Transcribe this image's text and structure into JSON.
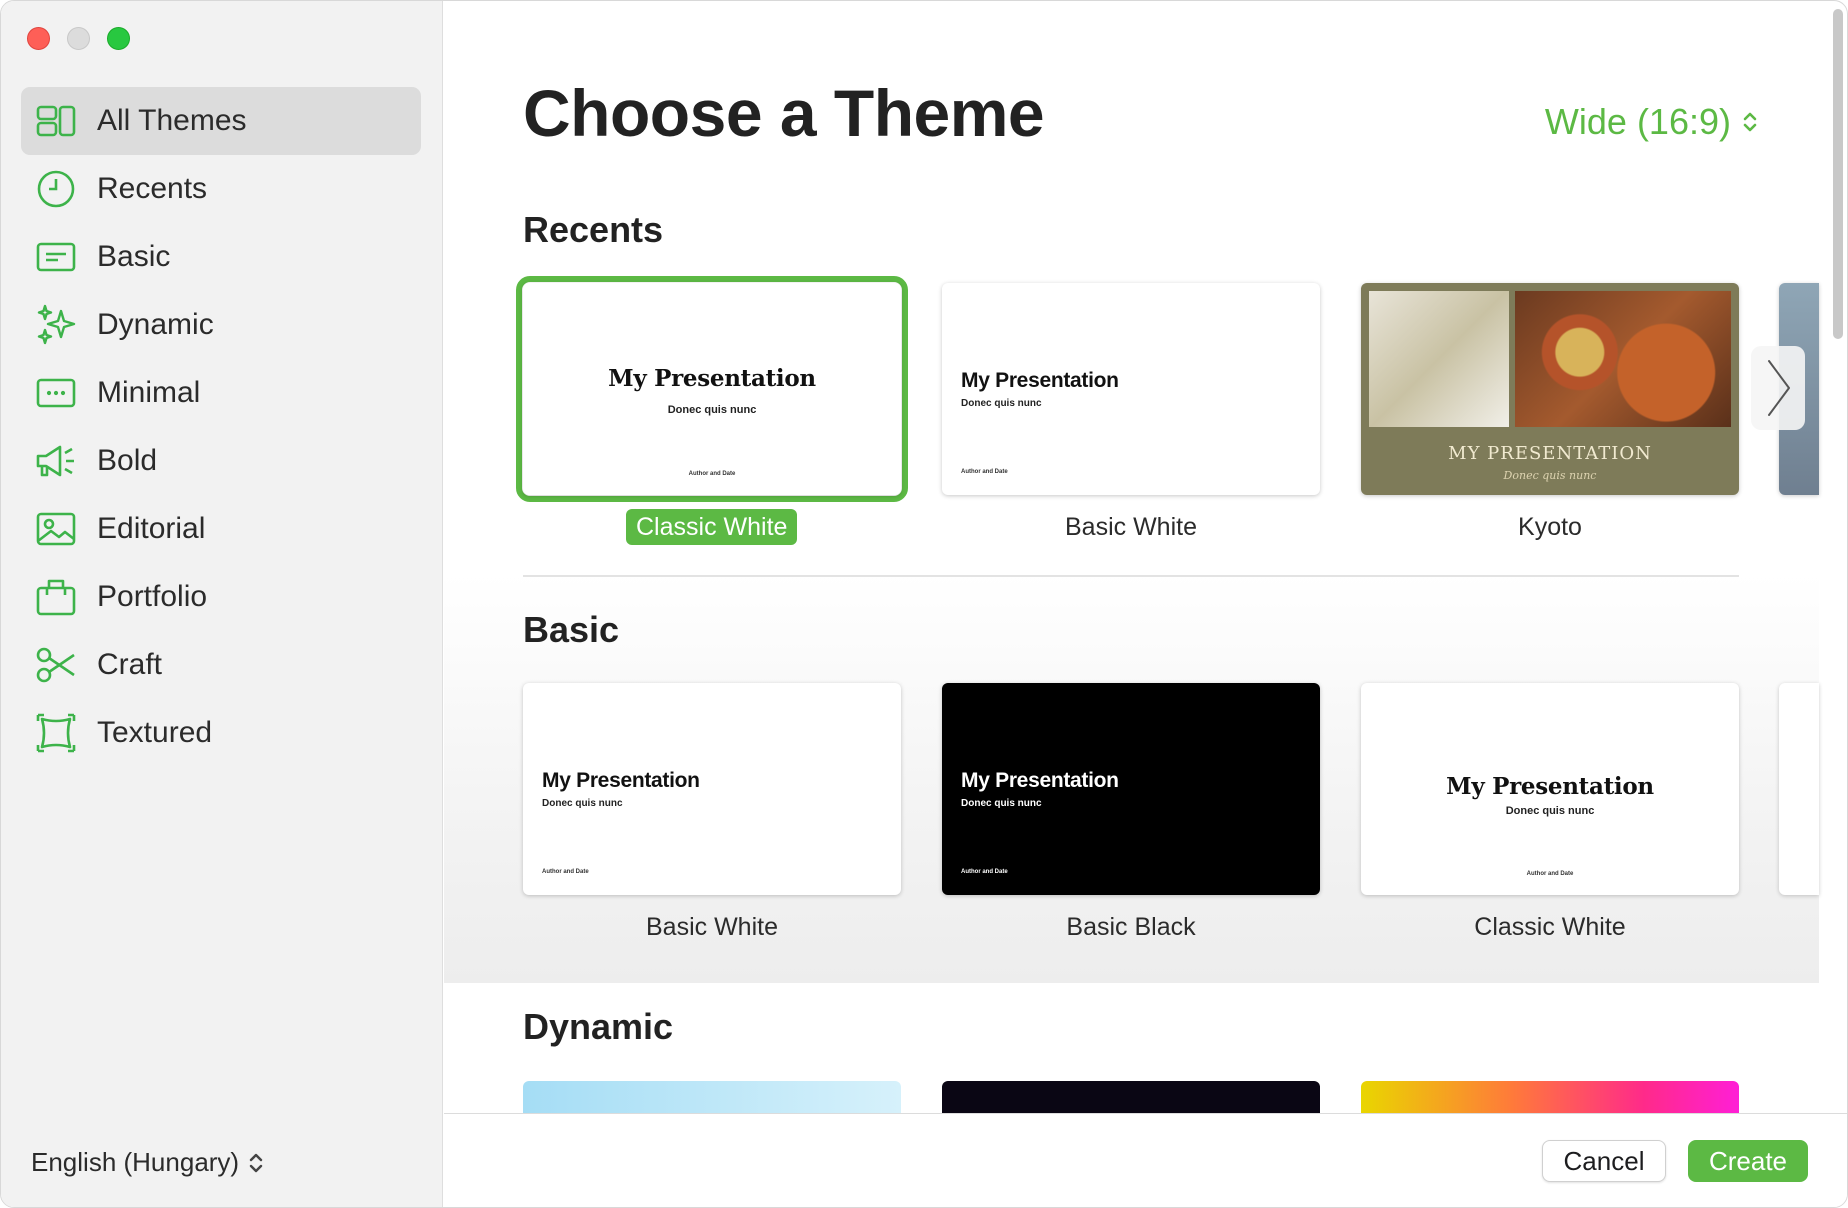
{
  "window": {
    "title": "Choose a Theme"
  },
  "sidebar": {
    "items": [
      {
        "label": "All Themes",
        "icon": "all-themes-icon",
        "active": true
      },
      {
        "label": "Recents",
        "icon": "clock-icon"
      },
      {
        "label": "Basic",
        "icon": "basic-icon"
      },
      {
        "label": "Dynamic",
        "icon": "sparkles-icon"
      },
      {
        "label": "Minimal",
        "icon": "minimal-icon"
      },
      {
        "label": "Bold",
        "icon": "megaphone-icon"
      },
      {
        "label": "Editorial",
        "icon": "photo-icon"
      },
      {
        "label": "Portfolio",
        "icon": "portfolio-icon"
      },
      {
        "label": "Craft",
        "icon": "scissors-icon"
      },
      {
        "label": "Textured",
        "icon": "textured-icon"
      }
    ],
    "language": "English (Hungary)"
  },
  "header": {
    "aspect": "Wide (16:9)"
  },
  "sections": {
    "recents": {
      "title": "Recents",
      "themes": [
        {
          "name": "Classic White",
          "selected": true,
          "title": "My Presentation",
          "subtitle": "Donec quis nunc",
          "footer": "Author and Date"
        },
        {
          "name": "Basic White",
          "title": "My Presentation",
          "subtitle": "Donec quis nunc",
          "footer": "Author and Date"
        },
        {
          "name": "Kyoto",
          "title": "MY PRESENTATION",
          "subtitle": "Donec quis nunc"
        }
      ]
    },
    "basic": {
      "title": "Basic",
      "themes": [
        {
          "name": "Basic White",
          "title": "My Presentation",
          "subtitle": "Donec quis nunc",
          "footer": "Author and Date"
        },
        {
          "name": "Basic Black",
          "title": "My Presentation",
          "subtitle": "Donec quis nunc",
          "footer": "Author and Date"
        },
        {
          "name": "Classic White",
          "title": "My Presentation",
          "subtitle": "Donec quis nunc",
          "footer": "Author and Date"
        }
      ]
    },
    "dynamic": {
      "title": "Dynamic"
    }
  },
  "footer": {
    "cancel_label": "Cancel",
    "create_label": "Create"
  },
  "colors": {
    "accent": "#5cb944",
    "sidebar_bg": "#f2f2f2"
  }
}
